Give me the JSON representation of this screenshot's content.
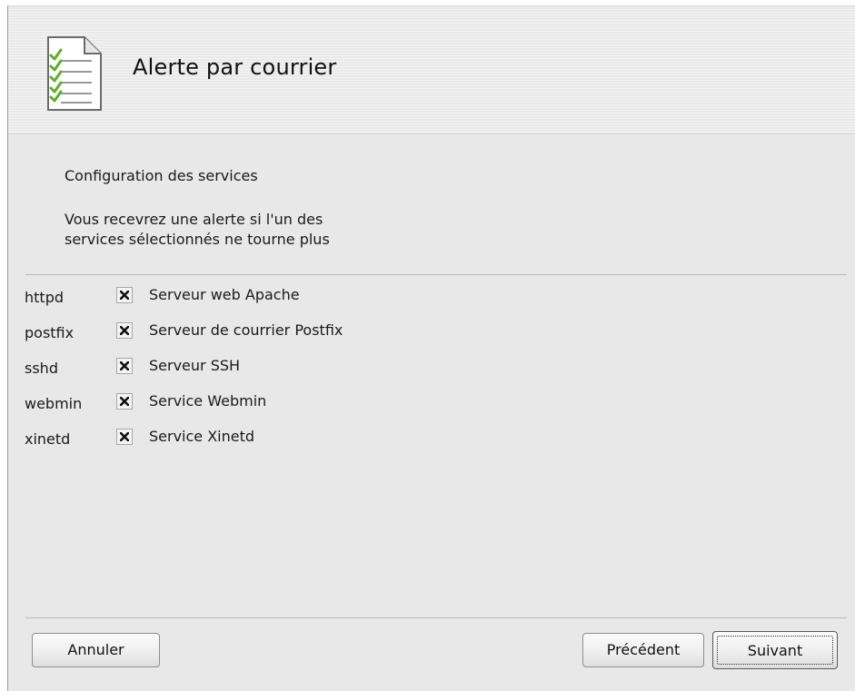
{
  "window": {
    "title": "Alerte par courrier",
    "header_icon": "checklist-document-icon"
  },
  "intro": {
    "heading": "Configuration des services",
    "description_line1": "Vous recevrez une alerte si l'un des",
    "description_line2": "services sélectionnés ne tourne plus"
  },
  "services": [
    {
      "name": "httpd",
      "label": "Serveur web Apache",
      "checked": true
    },
    {
      "name": "postfix",
      "label": "Serveur de courrier Postfix",
      "checked": true
    },
    {
      "name": "sshd",
      "label": "Serveur SSH",
      "checked": true
    },
    {
      "name": "webmin",
      "label": "Service Webmin",
      "checked": true
    },
    {
      "name": "xinetd",
      "label": "Service Xinetd",
      "checked": true
    }
  ],
  "buttons": {
    "cancel": "Annuler",
    "previous": "Précédent",
    "next": "Suivant"
  },
  "colors": {
    "background": "#e8e8e8",
    "checkmark_green": "#5fae2a"
  }
}
